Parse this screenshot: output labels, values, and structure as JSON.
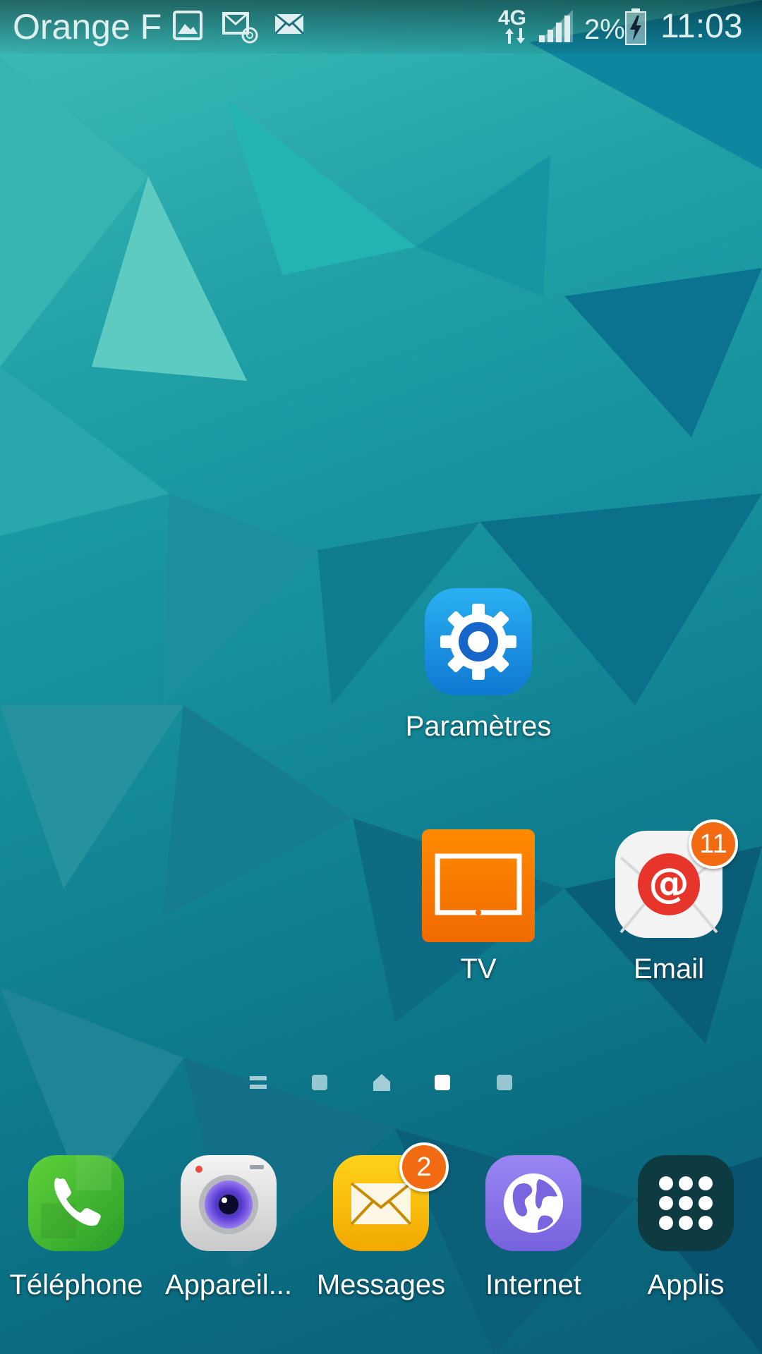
{
  "status_bar": {
    "carrier": "Orange F",
    "network": "4G",
    "battery_percent": "2%",
    "time": "11:03",
    "notification_icons": [
      "gallery-icon",
      "mms-icon",
      "email-icon"
    ]
  },
  "home_apps": [
    {
      "id": "parametres",
      "label": "Paramètres",
      "icon": "gear-icon",
      "badge": null
    },
    {
      "id": "tv",
      "label": "TV",
      "icon": "tv-icon",
      "badge": null
    },
    {
      "id": "email",
      "label": "Email",
      "icon": "email-at-icon",
      "badge": "11"
    }
  ],
  "pager": {
    "pages": 5,
    "current": 3,
    "icons": [
      "menu-icon",
      "dot",
      "home-icon",
      "dot",
      "dot"
    ]
  },
  "dock": [
    {
      "id": "telephone",
      "label": "Téléphone",
      "icon": "phone-icon",
      "badge": null
    },
    {
      "id": "appareil",
      "label": "Appareil...",
      "icon": "camera-icon",
      "badge": null
    },
    {
      "id": "messages",
      "label": "Messages",
      "icon": "messages-icon",
      "badge": "2"
    },
    {
      "id": "internet",
      "label": "Internet",
      "icon": "globe-icon",
      "badge": null
    },
    {
      "id": "applis",
      "label": "Applis",
      "icon": "apps-grid-icon",
      "badge": null
    }
  ],
  "colors": {
    "badge": "#f26a12",
    "settings": "#1e8ee6",
    "tv": "#ff7a00",
    "phone": "#3cb83c",
    "messages": "#f7b900",
    "internet": "#8a74e8",
    "applis": "#0e3a42"
  }
}
